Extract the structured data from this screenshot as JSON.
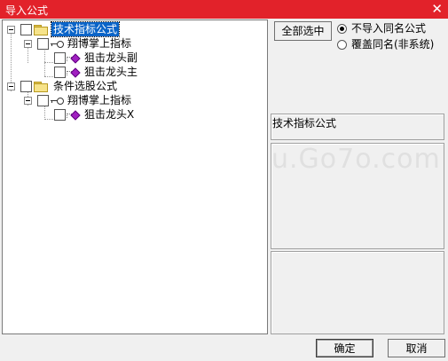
{
  "window": {
    "title": "导入公式",
    "close_glyph": "✕"
  },
  "tree": {
    "groups": [
      {
        "label": "技术指标公式",
        "selected": true,
        "children": [
          {
            "label": "翔博掌上指标",
            "items": [
              "狙击龙头副",
              "狙击龙头主"
            ]
          }
        ]
      },
      {
        "label": "条件选股公式",
        "selected": false,
        "children": [
          {
            "label": "翔博掌上指标",
            "items": [
              "狙击龙头X"
            ]
          }
        ]
      }
    ]
  },
  "options": {
    "select_all_label": "全部选中",
    "radios": [
      {
        "label": "不导入同名公式",
        "checked": true
      },
      {
        "label": "覆盖同名(非系统)",
        "checked": false
      }
    ]
  },
  "info": {
    "category_text": "技术指标公式"
  },
  "watermark": "u.Go7o.com",
  "buttons": {
    "ok_label": "确定",
    "cancel_label": "取消"
  },
  "icons": {
    "folder": "folder-icon",
    "key": "formula-key-icon",
    "gem": "formula-gem-icon"
  }
}
